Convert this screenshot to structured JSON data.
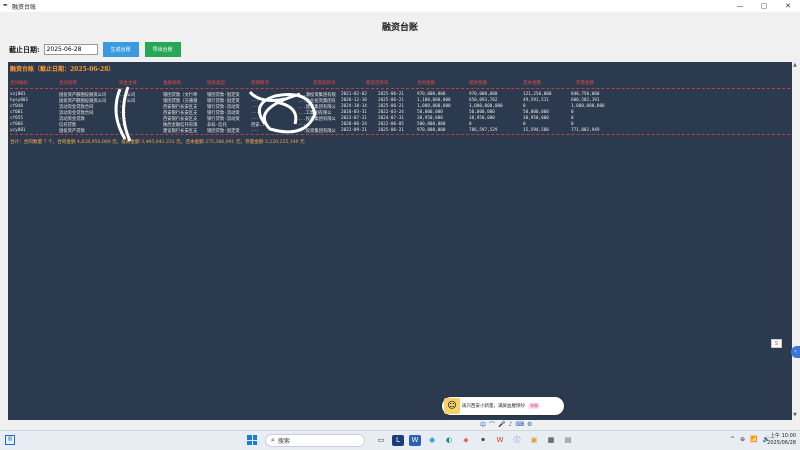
{
  "window": {
    "title": "融资台账",
    "controls": [
      "—",
      "▢",
      "✕"
    ]
  },
  "page_title": "融资台账",
  "toolbar": {
    "cutoff_label": "截止日期:",
    "cutoff_value": "2025-06-28",
    "generate_label": "生成台账",
    "export_label": "导出台账"
  },
  "panel": {
    "title": "融资台账（截止日期：2025-06-28）",
    "columns": [
      "合同编码",
      "合同名称",
      "资金主体",
      "金融机构",
      "融资类型",
      "担保情况",
      "首笔放款日",
      "最后还款日",
      "合同金额",
      "提款金额",
      "还本金额",
      "存量金额"
    ],
    "rows": [
      [
        "xzj001",
        "国投资产额图投融资公司",
        "...公司",
        "银团贷款（文行牵",
        "银团贷款·固定资",
        "...",
        "...源投资集团有限",
        "2021-02-02",
        "2025-06-21",
        "970,000,000",
        "970,000,000",
        "121,250,000",
        "848,750,000"
      ],
      [
        "hysy001",
        "国投资产额图投融资公司",
        "...公司",
        "银团贷款（交通银",
        "银行贷款·固定资",
        "...",
        "...企业投资集团有",
        "2020-12-10",
        "2025-06-21",
        "1,100,000,000",
        "650,093,702",
        "49,591,511",
        "600,502,191"
      ],
      [
        "cf048",
        "流动资金贷款合同",
        "...",
        "西安银行长安区支",
        "银行贷款·流动资",
        "...",
        "...建设集团有限公",
        "2024-10-14",
        "2025-06-21",
        "1,000,000,000",
        "1,000,000,000",
        "0",
        "1,000,000,000"
      ],
      [
        "cf001",
        "流动资金贷款合同",
        "...",
        "西安银行长安区支",
        "银行贷款·流动资",
        "...",
        "...工集团有限公",
        "2020-03-31",
        "2022-03-24",
        "50,000,000",
        "50,000,000",
        "50,000,000",
        "0"
      ],
      [
        "cf055",
        "流动资金贷款",
        "...",
        "西安银行长安区支",
        "银行贷款·流动资",
        "...",
        "...投资集团有限公",
        "2023-07-31",
        "2024-07-31",
        "38,950,000",
        "38,950,000",
        "38,950,000",
        "0"
      ],
      [
        "cf066",
        "信托贷款",
        "...",
        "陕西金融信托有限",
        "非标·信托",
        "西安...",
        "...",
        "2020-06-24",
        "2022-06-05",
        "500,000,000",
        "0",
        "0",
        "0"
      ],
      [
        "ycy001",
        "国投资产贷款",
        "...",
        "建设银行长安区支",
        "银团贷款·固定资",
        "...",
        "...投资集团有限公",
        "2022-09-21",
        "2025-06-21",
        "970,000,000",
        "786,597,529",
        "15,594,580",
        "771,002,949"
      ]
    ],
    "summary": "合计：合同数量 7 个，合同金额 4,628,950,000 元，提款金额 3,495,641,231 元，还本金额 275,386,091 元，存量金额 3,220,255,140 元"
  },
  "toast": {
    "text": "再只西安小新量，满屏血腥惊吵",
    "tag": "弹幕",
    "close": "✕"
  },
  "ime": [
    "中",
    "⌒",
    "🎤",
    "♪",
    "⌨",
    "⚙"
  ],
  "taskbar": {
    "search_placeholder": "搜索",
    "apps": [
      "▭",
      "L",
      "W",
      "◉",
      "◐",
      "◈",
      "⚫",
      "W",
      "ⓘ",
      "▣",
      "▦",
      "▤"
    ],
    "tray": [
      "^",
      "⊕",
      "📶",
      "🔊"
    ],
    "time": "上午 10:00",
    "date": "2025/06/28"
  },
  "colors": {
    "panel_bg": "#2b3a4e",
    "header_text": "#e84b4b",
    "title_text": "#ff9b2f",
    "summary_text": "#ffb24a",
    "generate_btn": "#3b9be0",
    "export_btn": "#27a857"
  }
}
